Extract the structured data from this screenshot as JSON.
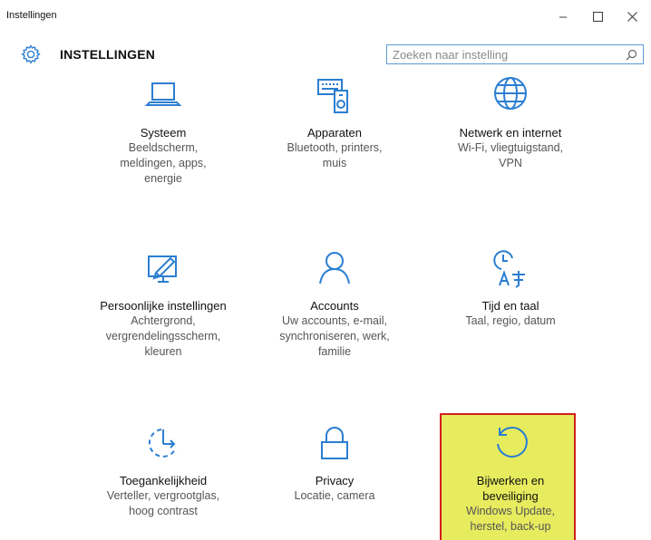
{
  "window": {
    "title": "Instellingen",
    "minimize_glyph": "–",
    "maximize_glyph": "☐",
    "close_glyph": "✕"
  },
  "header": {
    "title": "INSTELLINGEN",
    "search_placeholder": "Zoeken naar instelling",
    "gear_icon": "gear-icon",
    "search_icon": "search-icon"
  },
  "tiles": [
    {
      "title": "Systeem",
      "desc": "Beeldscherm,\nmeldingen, apps,\nenergie",
      "icon": "laptop-icon"
    },
    {
      "title": "Apparaten",
      "desc": "Bluetooth, printers,\nmuis",
      "icon": "devices-icon"
    },
    {
      "title": "Netwerk en internet",
      "desc": "Wi-Fi, vliegtuigstand,\nVPN",
      "icon": "globe-icon"
    },
    {
      "title": "Persoonlijke instellingen",
      "desc": "Achtergrond,\nvergrendelingsscherm,\nkleuren",
      "icon": "personalization-icon"
    },
    {
      "title": "Accounts",
      "desc": "Uw accounts, e-mail,\nsynchroniseren, werk,\nfamilie",
      "icon": "person-icon"
    },
    {
      "title": "Tijd en taal",
      "desc": "Taal, regio, datum",
      "icon": "time-language-icon"
    },
    {
      "title": "Toegankelijkheid",
      "desc": "Verteller, vergrootglas,\nhoog contrast",
      "icon": "accessibility-icon"
    },
    {
      "title": "Privacy",
      "desc": "Locatie, camera",
      "icon": "lock-icon"
    },
    {
      "title": "Bijwerken en\nbeveiliging",
      "desc": "Windows Update,\nherstel, back-up",
      "icon": "refresh-icon"
    }
  ],
  "colors": {
    "highlight_fill": "#e7eb5e",
    "highlight_border": "#d21f1f",
    "search_border": "#5b9bd5"
  }
}
